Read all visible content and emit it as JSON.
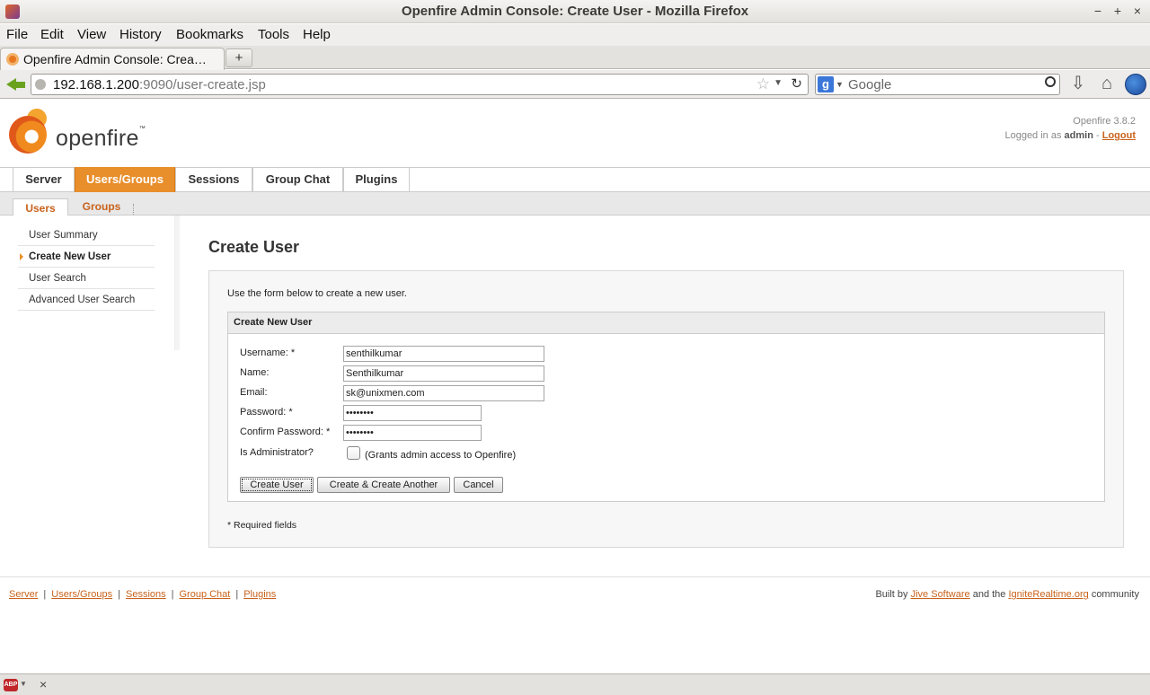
{
  "window": {
    "title": "Openfire Admin Console: Create User - Mozilla Firefox",
    "controls": [
      "−",
      "+",
      "×"
    ]
  },
  "menubar": [
    "File",
    "Edit",
    "View",
    "History",
    "Bookmarks",
    "Tools",
    "Help"
  ],
  "tabs": [
    {
      "label": "Openfire Admin Console: Crea…"
    }
  ],
  "new_tab_label": "+",
  "urlbar": {
    "host": "192.168.1.200",
    "rest": ":9090/user-create.jsp"
  },
  "search": {
    "placeholder": "Google",
    "engine_letter": "g"
  },
  "header": {
    "logo_text": "openfire",
    "logo_tm": "™",
    "version": "Openfire 3.8.2",
    "logged_in_prefix": "Logged in as",
    "user": "admin",
    "separator": "-",
    "logout": "Logout"
  },
  "main_nav": [
    "Server",
    "Users/Groups",
    "Sessions",
    "Group Chat",
    "Plugins"
  ],
  "sub_nav": [
    "Users",
    "Groups"
  ],
  "sidebar": [
    "User Summary",
    "Create New User",
    "User Search",
    "Advanced User Search"
  ],
  "content": {
    "title": "Create User",
    "intro": "Use the form below to create a new user.",
    "fieldset_title": "Create New User",
    "labels": {
      "username": "Username: *",
      "name": "Name:",
      "email": "Email:",
      "password": "Password: *",
      "confirm": "Confirm Password: *",
      "is_admin": "Is Administrator?",
      "admin_note": "(Grants admin access to Openfire)"
    },
    "values": {
      "username": "senthilkumar",
      "name": "Senthilkumar",
      "email": "sk@unixmen.com",
      "password": "••••••••",
      "confirm": "••••••••"
    },
    "buttons": {
      "create": "Create User",
      "create_another": "Create & Create Another",
      "cancel": "Cancel"
    },
    "required_note": "* Required fields"
  },
  "footer": {
    "links": [
      "Server",
      "Users/Groups",
      "Sessions",
      "Group Chat",
      "Plugins"
    ],
    "credit_prefix": "Built by",
    "credit_link1": "Jive Software",
    "credit_mid": "and the",
    "credit_link2": "IgniteRealtime.org",
    "credit_suffix": "community"
  },
  "statusbar": {
    "abp": "ABP",
    "close": "×"
  },
  "colors": {
    "accent": "#e88e2b",
    "link": "#c8621b"
  }
}
